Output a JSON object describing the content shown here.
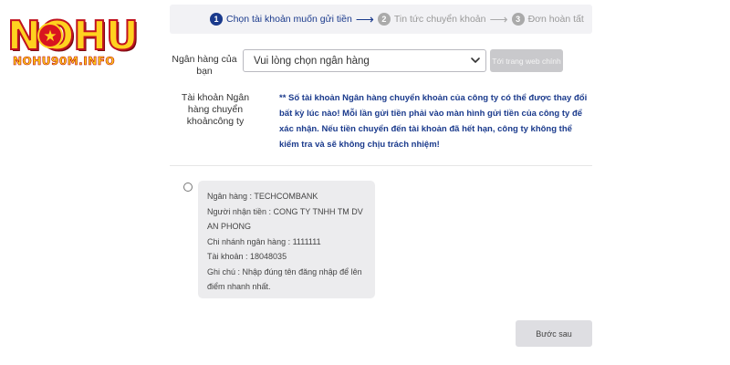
{
  "logo": {
    "main": "NOHU",
    "sub": "NOHU90M.INFO"
  },
  "stepper": {
    "steps": [
      {
        "number": "1",
        "label": "Chọn tài khoản muốn gửi tiền"
      },
      {
        "number": "2",
        "label": "Tin tức chuyển khoản"
      },
      {
        "number": "3",
        "label": "Đơn hoàn tất"
      }
    ],
    "arrow": "⟶"
  },
  "form": {
    "bank_label": "Ngân hàng của bạn",
    "bank_select_value": "Vui lòng chọn ngân hàng",
    "web_button": "Tới trang web chính",
    "account_label": "Tài khoản Ngân hàng chuyển khoảncông ty",
    "notice": "** Số tài khoản Ngân hàng chuyển khoản của công ty có thể được thay đổi bất kỳ lúc nào! Mỗi lần gửi tiền phải vào màn hình gửi tiền của công ty để xác nhận. Nếu tiền chuyển đến tài khoản đã hết hạn, công ty không thể kiểm tra và sẽ không chịu trách nhiệm!"
  },
  "account_card": {
    "bank": "Ngân hàng : TECHCOMBANK",
    "recipient": "Người nhận tiền : CONG TY TNHH TM DV AN PHONG",
    "branch": "Chi nhánh ngân hàng : 1111111",
    "account": "Tài khoản : 18048035",
    "note": "Ghi chú : Nhập đúng tên đăng nhập để lên điểm nhanh nhất."
  },
  "next_button": "Bước sau",
  "colors": {
    "accent": "#1a3a8c",
    "inactive": "#999999",
    "card_bg": "#ececee"
  }
}
